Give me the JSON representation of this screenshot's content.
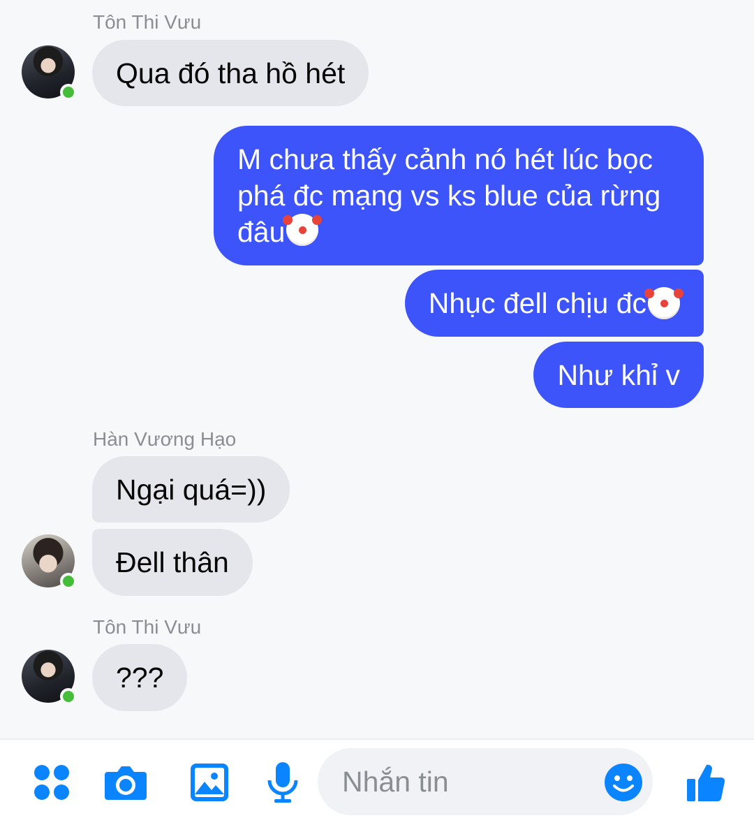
{
  "conversation": {
    "messages": [
      {
        "sender": "Tôn Thi Vưu",
        "text": "Qua đó tha hồ hét"
      },
      {
        "text": "M chưa thấy cảnh nó hét lúc bọc phá đc mạng vs ks blue của rừng đâu"
      },
      {
        "text": "Nhục đell chịu đc"
      },
      {
        "text": "Như khỉ v"
      },
      {
        "sender": "Hàn Vương Hạo",
        "text": "Ngại quá=))"
      },
      {
        "text": "Đell thân"
      },
      {
        "sender": "Tôn Thi Vưu",
        "text": "???"
      }
    ],
    "emoji": "clown-face"
  },
  "composer": {
    "placeholder": "Nhắn tin",
    "icons": [
      "apps-icon",
      "camera-icon",
      "image-icon",
      "microphone-icon",
      "emoji-icon",
      "like-icon"
    ]
  },
  "colors": {
    "outgoing_bubble": "#3d54fb",
    "incoming_bubble": "#e4e6eb",
    "online_dot": "#45bd3a",
    "toolbar_icon": "#0a84ff"
  }
}
